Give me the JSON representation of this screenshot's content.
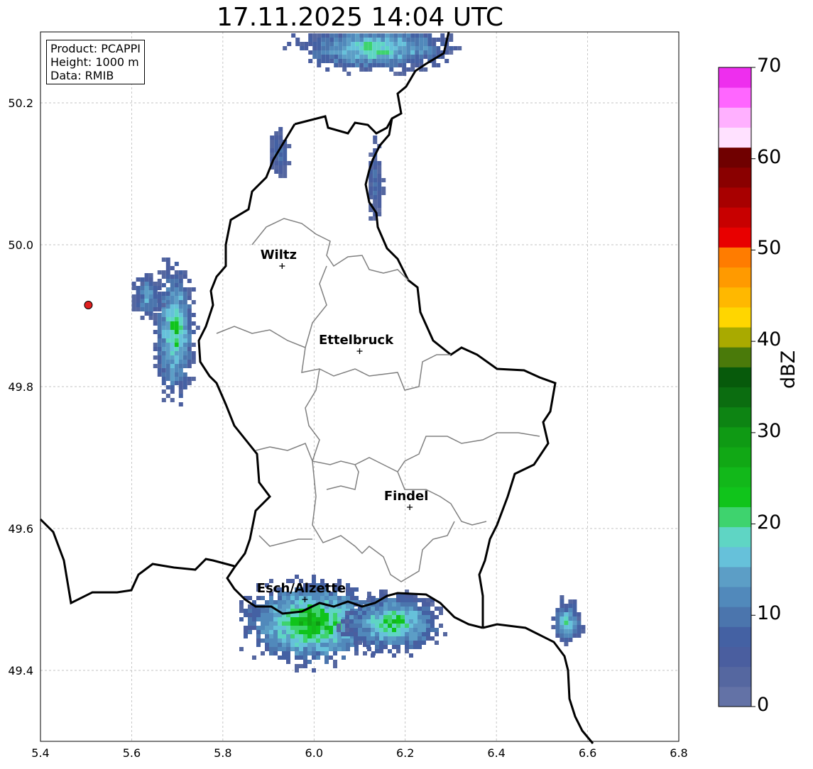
{
  "title": "17.11.2025 14:04 UTC",
  "info": {
    "product": "Product: PCAPPI",
    "height": "Height: 1000 m",
    "data": "Data: RMIB"
  },
  "axes": {
    "x_ticks": [
      "5.4",
      "5.6",
      "5.8",
      "6.0",
      "6.2",
      "6.4",
      "6.6",
      "6.8"
    ],
    "y_ticks": [
      "49.4",
      "49.6",
      "49.8",
      "50.0",
      "50.2"
    ],
    "xlim": [
      5.4,
      6.8
    ],
    "ylim": [
      49.3,
      50.3
    ]
  },
  "cities": [
    {
      "name": "Wiltz",
      "lon": 5.93,
      "lat": 49.97
    },
    {
      "name": "Ettelbruck",
      "lon": 6.1,
      "lat": 49.85
    },
    {
      "name": "Findel",
      "lon": 6.21,
      "lat": 49.63
    },
    {
      "name": "Esch/Alzette",
      "lon": 5.98,
      "lat": 49.5
    }
  ],
  "radar_site": {
    "lon": 5.505,
    "lat": 49.915,
    "color": "#e02020"
  },
  "colorbar": {
    "unit": "dBZ",
    "ticks": [
      "0",
      "10",
      "20",
      "30",
      "40",
      "50",
      "60",
      "70"
    ],
    "min": 0,
    "max": 70,
    "colors": [
      "#6372a6",
      "#5567a0",
      "#4a5e9f",
      "#4461a3",
      "#4b75ad",
      "#5189bb",
      "#5c9ec6",
      "#66c1da",
      "#5fd5c4",
      "#3ed36e",
      "#10c41b",
      "#12b81a",
      "#11a815",
      "#0f9a14",
      "#0d8413",
      "#0b6d10",
      "#075a0b",
      "#4a7a0a",
      "#a9aa00",
      "#ffd600",
      "#ffb800",
      "#ff9a00",
      "#ff7c00",
      "#e80000",
      "#c80000",
      "#a80000",
      "#8a0000",
      "#700000",
      "#ffe1ff",
      "#ffb0ff",
      "#ff66ff",
      "#ee2eee"
    ]
  },
  "echo_cells": [
    {
      "lon": 5.99,
      "lat": 49.47,
      "rlon": 0.14,
      "rlat": 0.055,
      "peak": 28
    },
    {
      "lon": 6.17,
      "lat": 49.47,
      "rlon": 0.1,
      "rlat": 0.04,
      "peak": 24
    },
    {
      "lon": 6.55,
      "lat": 49.47,
      "rlon": 0.03,
      "rlat": 0.03,
      "peak": 20
    },
    {
      "lon": 5.69,
      "lat": 49.88,
      "rlon": 0.04,
      "rlat": 0.09,
      "peak": 24
    },
    {
      "lon": 5.63,
      "lat": 49.93,
      "rlon": 0.03,
      "rlat": 0.03,
      "peak": 15
    },
    {
      "lon": 6.13,
      "lat": 50.28,
      "rlon": 0.16,
      "rlat": 0.03,
      "peak": 22
    },
    {
      "lon": 5.92,
      "lat": 50.13,
      "rlon": 0.02,
      "rlat": 0.03,
      "peak": 10
    },
    {
      "lon": 6.13,
      "lat": 50.09,
      "rlon": 0.015,
      "rlat": 0.05,
      "peak": 10
    }
  ]
}
